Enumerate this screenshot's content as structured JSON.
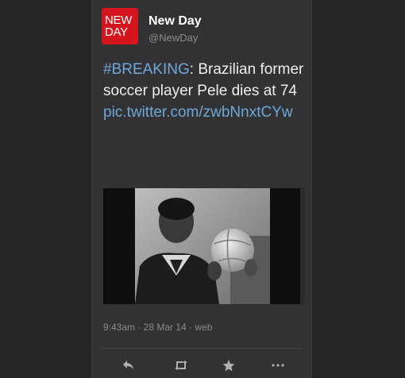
{
  "account": {
    "logo_line1": "NEW",
    "logo_line2": "DAY",
    "name": "New Day",
    "handle": "@NewDay"
  },
  "tweet": {
    "hashtag": "#BREAKING",
    "text": ": Brazilian former soccer player Pele dies at 74",
    "link": "pic.twitter.com/zwbNnxtCYw"
  },
  "media": {
    "description_icon": "photo"
  },
  "meta": {
    "timestamp": "9:43am · 28 Mar 14 · web"
  },
  "actions": {
    "reply_icon": "reply-icon",
    "retweet_icon": "retweet-icon",
    "favorite_icon": "star-icon",
    "more_icon": "more-icon"
  },
  "colors": {
    "brand_red": "#d4151d",
    "link_blue": "#6ea8d8",
    "card_bg": "#323234"
  }
}
